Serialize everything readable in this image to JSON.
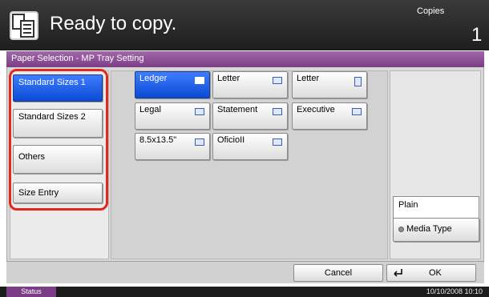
{
  "header": {
    "title": "Ready to copy.",
    "copies_label": "Copies",
    "copies_value": "1"
  },
  "screen_title": "Paper Selection - MP Tray Setting",
  "left_menu": [
    {
      "label": "Standard Sizes 1",
      "selected": true
    },
    {
      "label": "Standard Sizes 2",
      "selected": false
    },
    {
      "label": "Others",
      "selected": false
    },
    {
      "label": "Size Entry",
      "selected": false
    }
  ],
  "paper_sizes": [
    {
      "label": "Ledger",
      "selected": true,
      "orientation": "landscape"
    },
    {
      "label": "Letter",
      "selected": false,
      "orientation": "landscape"
    },
    {
      "label": "Letter",
      "selected": false,
      "orientation": "portrait"
    },
    {
      "label": "Legal",
      "selected": false,
      "orientation": "landscape"
    },
    {
      "label": "Statement",
      "selected": false,
      "orientation": "landscape"
    },
    {
      "label": "Executive",
      "selected": false,
      "orientation": "landscape"
    },
    {
      "label": "8.5x13.5\"",
      "selected": false,
      "orientation": "landscape"
    },
    {
      "label": "OficioII",
      "selected": false,
      "orientation": "landscape"
    }
  ],
  "media": {
    "current": "Plain",
    "button_label": "Media Type"
  },
  "actions": {
    "cancel": "Cancel",
    "ok": "OK"
  },
  "footer": {
    "status": "Status",
    "datetime": "10/10/2008   10:10"
  },
  "colors": {
    "selected": "#0a4bd4",
    "title_bar": "#7b3e86",
    "highlight_outline": "#e0281e"
  }
}
